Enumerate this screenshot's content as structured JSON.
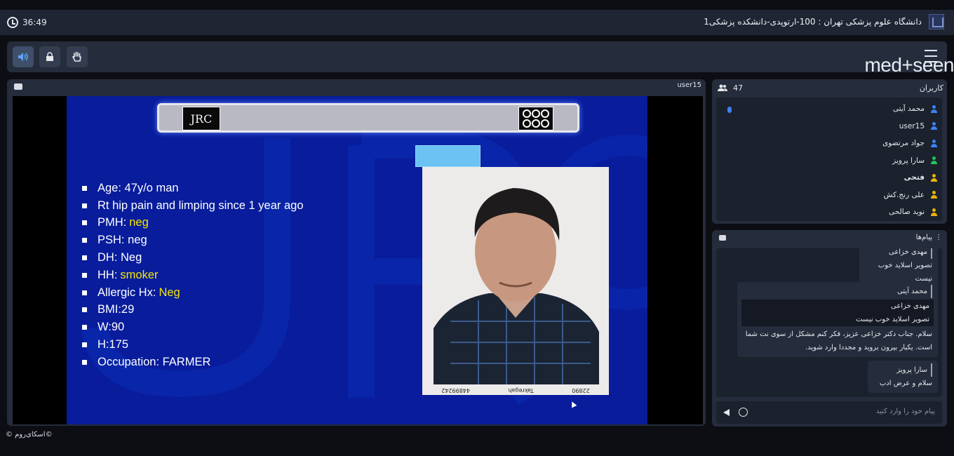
{
  "header": {
    "timer": "36:49",
    "room_title": "دانشگاه علوم پزشکی تهران : 100-ارتوپدی-دانشکده پزشکی1"
  },
  "toolbar": {
    "icons": [
      "speaker-icon",
      "lock-icon",
      "hand-icon",
      "menu-icon"
    ]
  },
  "brand": {
    "name": "med+seen"
  },
  "video": {
    "presenter": "user15",
    "slide": {
      "logo_left": "JRC",
      "bullets": [
        {
          "text": "Age: 47y/o man",
          "highlight": ""
        },
        {
          "text": "Rt hip pain and limping since 1 year ago",
          "highlight": ""
        },
        {
          "text": "PMH:",
          "highlight": "neg"
        },
        {
          "text": "PSH: neg",
          "highlight": ""
        },
        {
          "text": "DH: Neg",
          "highlight": ""
        },
        {
          "text": "HH:",
          "highlight": "smoker"
        },
        {
          "text": "Allergic Hx:",
          "highlight": "Neg"
        },
        {
          "text": "BMI:29",
          "highlight": ""
        },
        {
          "text": "W:90",
          "highlight": ""
        },
        {
          "text": "H:175",
          "highlight": ""
        },
        {
          "text": "Occupation: FARMER",
          "highlight": ""
        }
      ],
      "photo_codes": [
        "22890",
        "Takregah",
        "44899242"
      ]
    }
  },
  "users": {
    "title": "کاربران",
    "count": "47",
    "list": [
      {
        "name": "محمد آیتی",
        "color": "#3b82f6",
        "bold": false
      },
      {
        "name": "user15",
        "color": "#3b82f6",
        "bold": false
      },
      {
        "name": "جواد مرتضوی",
        "color": "#3b82f6",
        "bold": false
      },
      {
        "name": "سارا پرویز",
        "color": "#22c55e",
        "bold": false
      },
      {
        "name": "فتحی",
        "color": "#eab308",
        "bold": true
      },
      {
        "name": "علی رنج.کش",
        "color": "#eab308",
        "bold": false
      },
      {
        "name": "نوید صالحی",
        "color": "#eab308",
        "bold": false
      }
    ]
  },
  "chat": {
    "title": "پیام‌ها",
    "messages": [
      {
        "name": "مهدی خزاعی",
        "quote_name": "",
        "quote_text": "",
        "text": "تصویر اسلاید خوب نیست"
      },
      {
        "name": "محمد آیتی",
        "quote_name": "مهدی خزاعی",
        "quote_text": "تصویر اسلاید خوب نیست",
        "text": "سلام. جناب دکتر خزاعی عزیز، فکر کنم مشکل از سوی نت شما است. یکبار بیرون بروید و مجددا وارد شوید."
      },
      {
        "name": "سارا پرویز",
        "quote_name": "",
        "quote_text": "",
        "text": "سلام و عرض ادب"
      }
    ],
    "input_placeholder": "پیام خود را وارد کنید"
  },
  "footer": {
    "text": "©اسکای‌روم ©"
  }
}
